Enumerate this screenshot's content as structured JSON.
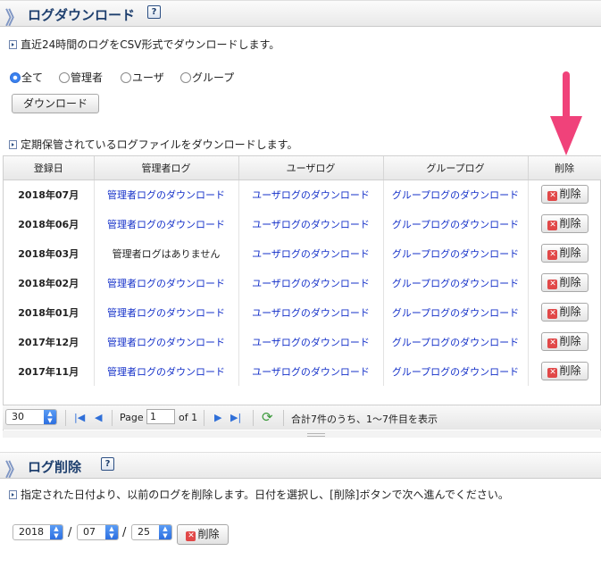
{
  "download_section": {
    "title": "ログダウンロード",
    "help": "?",
    "desc_recent": "直近24時間のログをCSV形式でダウンロードします。",
    "radios": [
      {
        "label": "全て",
        "checked": true
      },
      {
        "label": "管理者",
        "checked": false
      },
      {
        "label": "ユーザ",
        "checked": false
      },
      {
        "label": "グループ",
        "checked": false
      }
    ],
    "download_button": "ダウンロード",
    "desc_archive": "定期保管されているログファイルをダウンロードします。"
  },
  "table": {
    "headers": [
      "登録日",
      "管理者ログ",
      "ユーザログ",
      "グループログ",
      "削除"
    ],
    "rows": [
      {
        "date": "2018年07月",
        "admin": "管理者ログのダウンロード",
        "user": "ユーザログのダウンロード",
        "group": "グループログのダウンロード",
        "admin_link": true
      },
      {
        "date": "2018年06月",
        "admin": "管理者ログのダウンロード",
        "user": "ユーザログのダウンロード",
        "group": "グループログのダウンロード",
        "admin_link": true
      },
      {
        "date": "2018年03月",
        "admin": "管理者ログはありません",
        "user": "ユーザログのダウンロード",
        "group": "グループログのダウンロード",
        "admin_link": false
      },
      {
        "date": "2018年02月",
        "admin": "管理者ログのダウンロード",
        "user": "ユーザログのダウンロード",
        "group": "グループログのダウンロード",
        "admin_link": true
      },
      {
        "date": "2018年01月",
        "admin": "管理者ログのダウンロード",
        "user": "ユーザログのダウンロード",
        "group": "グループログのダウンロード",
        "admin_link": true
      },
      {
        "date": "2017年12月",
        "admin": "管理者ログのダウンロード",
        "user": "ユーザログのダウンロード",
        "group": "グループログのダウンロード",
        "admin_link": true
      },
      {
        "date": "2017年11月",
        "admin": "管理者ログのダウンロード",
        "user": "ユーザログのダウンロード",
        "group": "グループログのダウンロード",
        "admin_link": true
      }
    ],
    "delete_label": "削除"
  },
  "pager": {
    "page_size": "30",
    "page_label": "Page",
    "page_value": "1",
    "of_label": "of 1",
    "summary": "合計7件のうち、1〜7件目を表示"
  },
  "delete_section": {
    "title": "ログ削除",
    "help": "?",
    "desc": "指定された日付より、以前のログを削除します。日付を選択し、[削除]ボタンで次へ進んでください。",
    "year": "2018",
    "month": "07",
    "day": "25",
    "separator": "/",
    "delete_label": "削除"
  },
  "colors": {
    "link": "#1531c9",
    "header_title": "#1e3f6e",
    "annotation_arrow": "#f0427a",
    "delete_icon": "#e14848"
  }
}
